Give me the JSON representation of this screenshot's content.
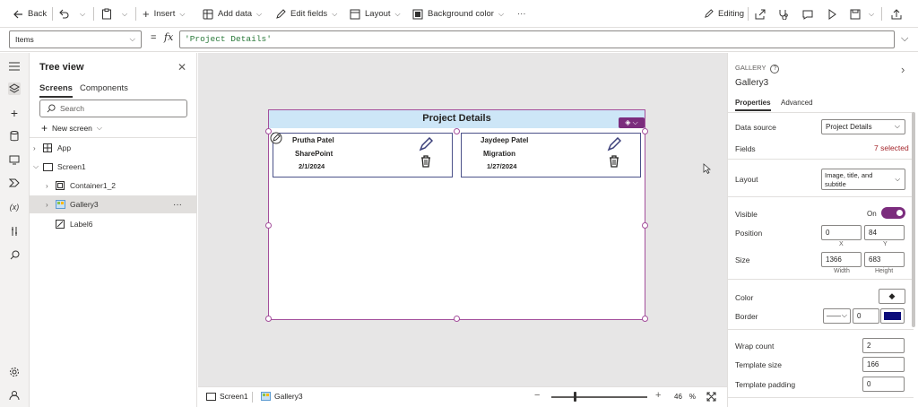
{
  "toolbar": {
    "back": "Back",
    "insert": "Insert",
    "add_data": "Add data",
    "edit_fields": "Edit fields",
    "layout": "Layout",
    "background_color": "Background color",
    "more": "···",
    "editing": "Editing"
  },
  "formula_bar": {
    "property": "Items",
    "fx": "fx",
    "formula": "'Project Details'"
  },
  "tree_view": {
    "title": "Tree view",
    "tabs": [
      "Screens",
      "Components"
    ],
    "search_placeholder": "Search",
    "new_screen": "New screen",
    "items": {
      "app": "App",
      "screen": "Screen1",
      "container": "Container1_2",
      "gallery": "Gallery3",
      "gallery_more": "···",
      "label": "Label6"
    }
  },
  "gallery": {
    "title": "Project Details",
    "cards": [
      {
        "name": "Prutha Patel",
        "source": "SharePoint",
        "date": "2/1/2024"
      },
      {
        "name": "Jaydeep Patel",
        "source": "Migration",
        "date": "1/27/2024"
      }
    ]
  },
  "bottom_bar": {
    "screen_tab": "Screen1",
    "gallery_tab": "Gallery3",
    "zoom_minus": "−",
    "zoom_plus": "+",
    "zoom_value": "46",
    "zoom_unit": "%"
  },
  "properties_panel": {
    "type_label": "GALLERY",
    "control_name": "Gallery3",
    "tabs": [
      "Properties",
      "Advanced"
    ],
    "data_source_label": "Data source",
    "data_source_value": "Project Details",
    "fields_label": "Fields",
    "fields_value": "7 selected",
    "layout_label": "Layout",
    "layout_value": "Image, title, and subtitle",
    "visible_label": "Visible",
    "visible_value": "On",
    "position_label": "Position",
    "position_x": "0",
    "position_y": "84",
    "x_label": "X",
    "y_label": "Y",
    "size_label": "Size",
    "width": "1366",
    "height": "683",
    "width_label": "Width",
    "height_label": "Height",
    "color_label": "Color",
    "border_label": "Border",
    "border_width": "0",
    "border_color": "#0b0c7a",
    "wrap_count_label": "Wrap count",
    "wrap_count": "2",
    "template_size_label": "Template size",
    "template_size": "166",
    "template_padding_label": "Template padding",
    "template_padding": "0"
  },
  "colors": {
    "accent": "#7b2c7d",
    "gallery_header": "#cde6f7",
    "card_border": "#4b5189"
  }
}
